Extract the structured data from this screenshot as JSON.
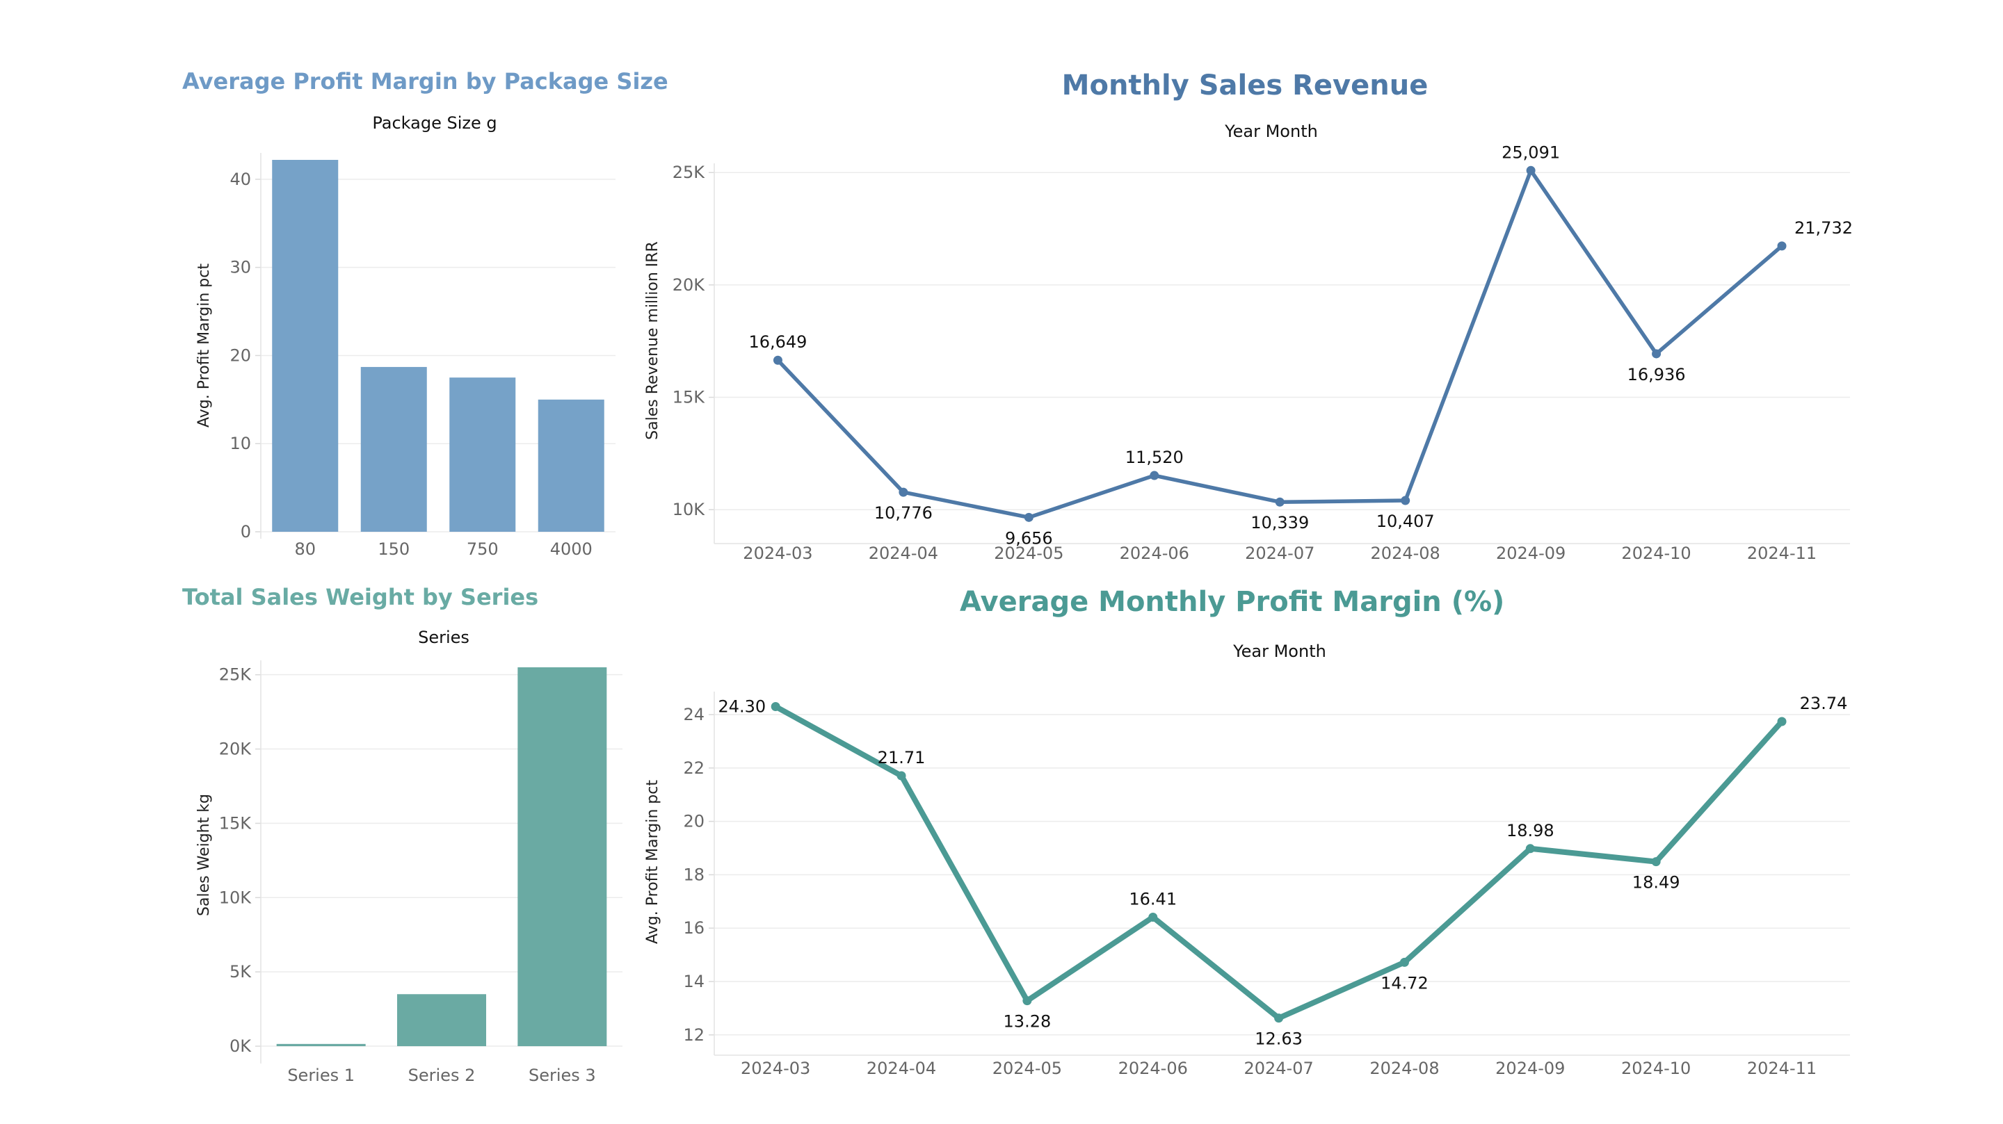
{
  "colors": {
    "blue": "#4e79a7",
    "blue_bar": "#76a2c8",
    "blue_title": "#6e9ac6",
    "teal": "#4b9a94",
    "teal_bar": "#6aaaa3",
    "teal_title": "#69aba4",
    "grid": "#ececec",
    "axis_text": "#666666",
    "label_text": "#111111"
  },
  "chart_data": [
    {
      "id": "profit-by-package",
      "type": "bar",
      "title": "Average Profit Margin by Package Size",
      "header": "Package Size g",
      "xlabel": "Package Size g",
      "ylabel": "Avg. Profit Margin pct",
      "categories": [
        "80",
        "150",
        "750",
        "4000"
      ],
      "values": [
        42.2,
        18.7,
        17.5,
        15.0
      ],
      "ylim": [
        0,
        42.2
      ],
      "yticks": [
        0,
        10,
        20,
        30,
        40
      ],
      "ytick_labels": [
        "0",
        "10",
        "20",
        "30",
        "40"
      ],
      "grid": true
    },
    {
      "id": "monthly-revenue",
      "type": "line",
      "title": "Monthly Sales Revenue",
      "header": "Year Month",
      "xlabel": "Year Month",
      "ylabel": "Sales Revenue million IRR",
      "categories": [
        "2024-03",
        "2024-04",
        "2024-05",
        "2024-06",
        "2024-07",
        "2024-08",
        "2024-09",
        "2024-10",
        "2024-11"
      ],
      "values": [
        16649,
        10776,
        9656,
        11520,
        10339,
        10407,
        25091,
        16936,
        21732
      ],
      "labels": [
        "16,649",
        "10,776",
        "9,656",
        "11,520",
        "10,339",
        "10,407",
        "25,091",
        "16,936",
        "21,732"
      ],
      "ylim": [
        8800,
        25100
      ],
      "yticks": [
        10000,
        15000,
        20000,
        25000
      ],
      "ytick_labels": [
        "10K",
        "15K",
        "20K",
        "25K"
      ],
      "grid": true
    },
    {
      "id": "weight-by-series",
      "type": "bar",
      "title": "Total Sales Weight by Series",
      "header": "Series",
      "xlabel": "Series",
      "ylabel": "Sales Weight kg",
      "categories": [
        "Series 1",
        "Series 2",
        "Series 3"
      ],
      "values": [
        150,
        3500,
        25500
      ],
      "ylim": [
        -700,
        25500
      ],
      "yticks": [
        0,
        5000,
        10000,
        15000,
        20000,
        25000
      ],
      "ytick_labels": [
        "0K",
        "5K",
        "10K",
        "15K",
        "20K",
        "25K"
      ],
      "grid": true
    },
    {
      "id": "monthly-margin",
      "type": "line",
      "title": "Average Monthly Profit Margin (%)",
      "header": "Year Month",
      "xlabel": "Year Month",
      "ylabel": "Avg. Profit Margin pct",
      "categories": [
        "2024-03",
        "2024-04",
        "2024-05",
        "2024-06",
        "2024-07",
        "2024-08",
        "2024-09",
        "2024-10",
        "2024-11"
      ],
      "values": [
        24.3,
        21.71,
        13.28,
        16.41,
        12.63,
        14.72,
        18.98,
        18.49,
        23.74
      ],
      "labels": [
        "24.30",
        "21.71",
        "13.28",
        "16.41",
        "12.63",
        "14.72",
        "18.98",
        "18.49",
        "23.74"
      ],
      "ylim": [
        11.5,
        24.6
      ],
      "yticks": [
        12,
        14,
        16,
        18,
        20,
        22,
        24
      ],
      "ytick_labels": [
        "12",
        "14",
        "16",
        "18",
        "20",
        "22",
        "24"
      ],
      "grid": true
    }
  ]
}
